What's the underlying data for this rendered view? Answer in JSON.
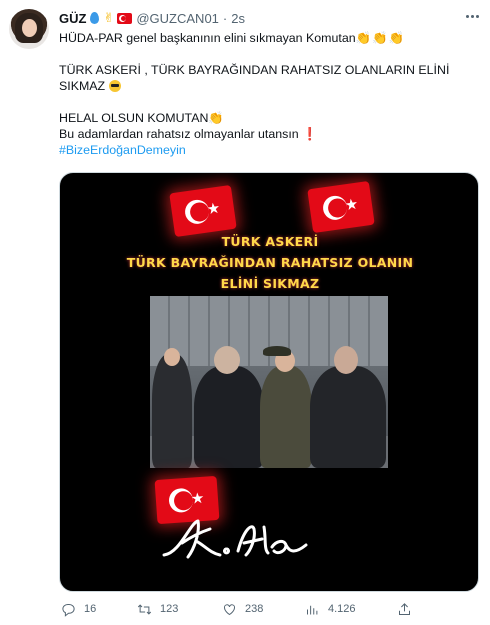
{
  "author": {
    "display_name": "GÜZ",
    "handle": "@GUZCAN01",
    "separator": "·",
    "time": "2s"
  },
  "tweet": {
    "lines": [
      "HÜDA-PAR genel başkanının elini sıkmayan Komutan",
      "TÜRK ASKERİ , TÜRK BAYRAĞINDAN RAHATSIZ OLANLARIN ELİNİ",
      "SIKMAZ",
      "HELAL OLSUN KOMUTAN",
      "Bu adamlardan rahatsız olmayanlar utansın"
    ],
    "claps_line1": "👏👏👏",
    "clap_line4": "👏",
    "exclamation": "❗",
    "hashtag": "#BizeErdoğanDemeyin"
  },
  "media": {
    "caption": [
      "TÜRK ASKERİ",
      "TÜRK BAYRAĞINDAN RAHATSIZ OLANIN",
      "ELİNİ SIKMAZ"
    ],
    "signature": "K.Ata"
  },
  "actions": {
    "replies": "16",
    "retweets": "123",
    "likes": "238",
    "views": "4.126"
  },
  "icons": [
    "more-icon",
    "reply-icon",
    "retweet-icon",
    "like-icon",
    "views-icon",
    "share-icon"
  ],
  "colors": {
    "link": "#1d9bf0",
    "muted": "#536471",
    "caption": "#ffd94a",
    "flag": "#e30a17"
  }
}
